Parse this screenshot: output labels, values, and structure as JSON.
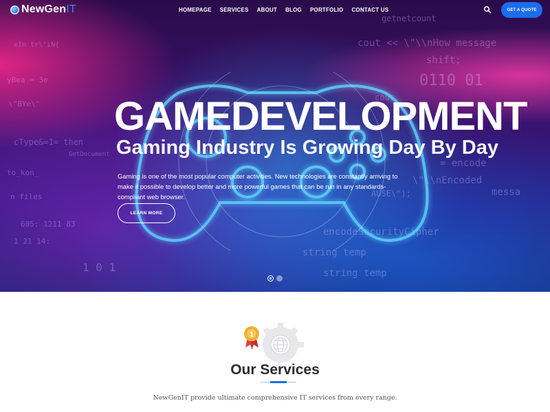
{
  "header": {
    "logo_main": "NewGen",
    "logo_accent": "IT",
    "menu": [
      "HOMEPAGE",
      "SERVICES",
      "ABOUT",
      "BLOG",
      "PORTFOLIO",
      "CONTACT US"
    ],
    "quote_label": "GET A QUOTE",
    "accent_color": "#1b6dea"
  },
  "hero": {
    "title": "GAMEDEVELOPMENT",
    "subtitle": "Gaming Industry Is Growing Day By Day",
    "description": "Gaming is one of the most popular computer activities. New technologies are constantly arriving to make it possible to develop better and more powerful games that can be run in any standards-compliant web browser.",
    "button_label": "LEARN MORE",
    "slide_count": 2,
    "active_slide": 1
  },
  "services": {
    "title": "Our Services",
    "description": "NewGenIT provide ultimate comprehensive IT services from every range."
  }
}
